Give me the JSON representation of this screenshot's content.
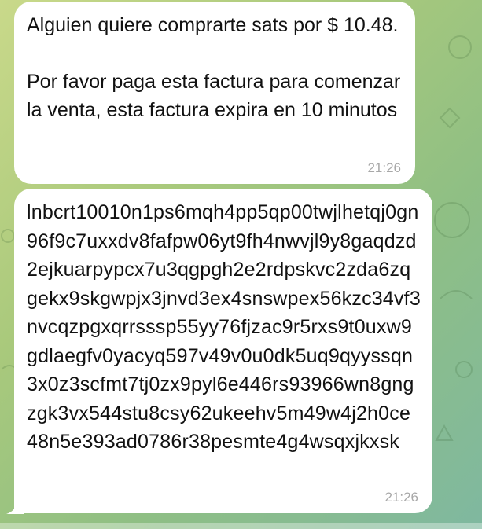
{
  "chat": {
    "messages": [
      {
        "text": "Alguien quiere comprarte sats por $ 10.48.\n\nPor favor paga esta factura para comenzar la venta, esta factura expira en 10 minutos",
        "time": "21:26"
      },
      {
        "text": "lnbcrt10010n1ps6mqh4pp5qp00twjlhetqj0gn96f9c7uxxdv8fafpw06yt9fh4nwvjl9y8gaqdzd2ejkuarpypcx7u3qgpgh2e2rdpskvc2zda6zqgekx9skgwpjx3jnvd3ex4snswpex56kzc34vf3nvcqzpgxqrrsssp55yy76fjzac9r5rxs9t0uxw9gdlaegfv0yacyq597v49v0u0dk5uq9qyyssqn3x0z3scfmt7tj0zx9pyl6e446rs93966wn8gngzgk3vx544stu8csy62ukeehv5m49w4j2h0ce48n5e393ad0786r38pesmte4g4wsqxjkxsk",
        "time": "21:26"
      }
    ]
  },
  "colors": {
    "bubble": "#ffffff",
    "timestamp": "#a8a8a8",
    "wallpaper_start": "#c9d98a",
    "wallpaper_end": "#7fb8a0"
  }
}
